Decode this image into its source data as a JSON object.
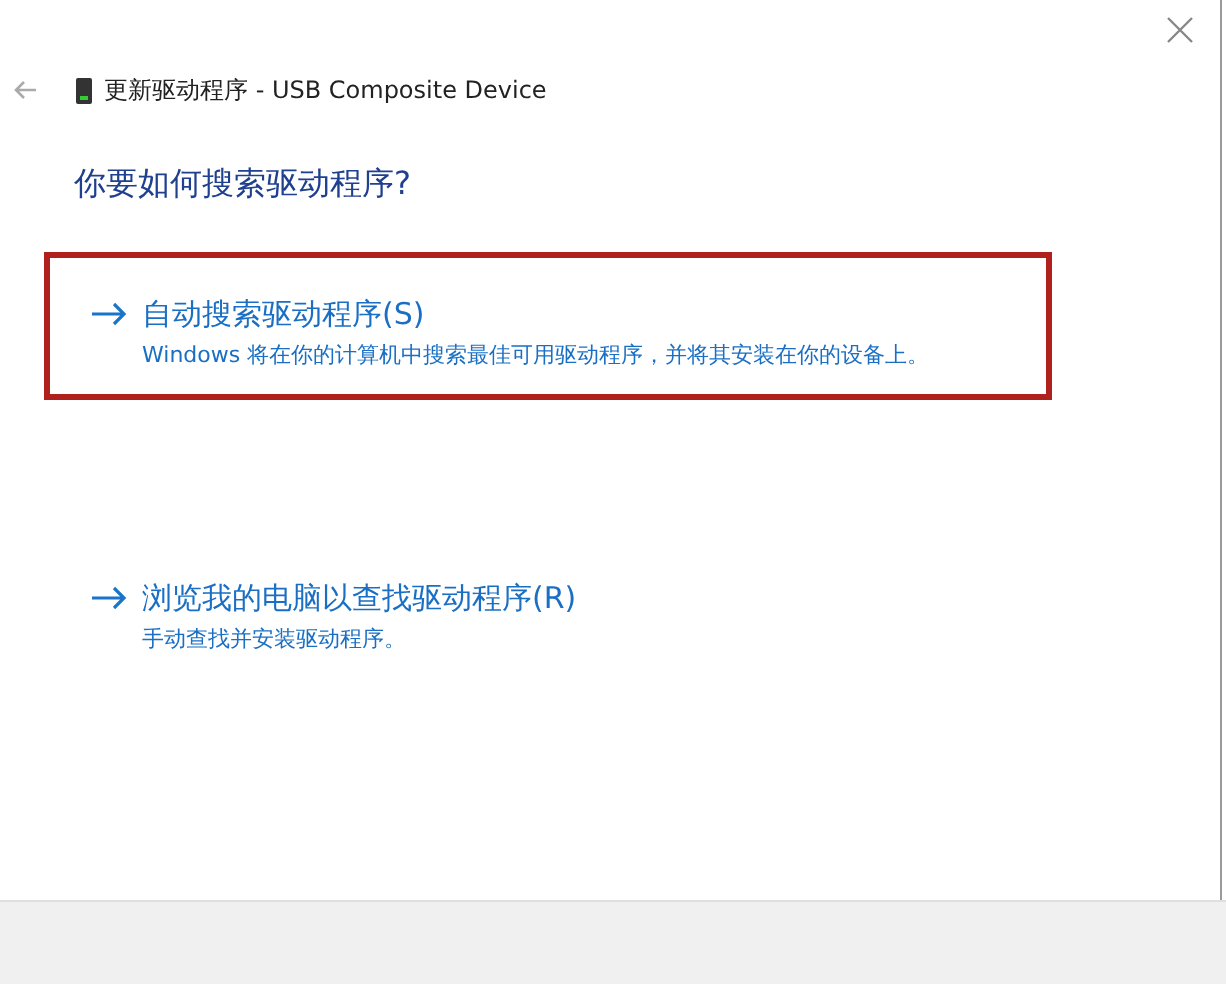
{
  "window": {
    "title": "更新驱动程序 - USB Composite Device"
  },
  "heading": "你要如何搜索驱动程序?",
  "options": [
    {
      "label": "自动搜索驱动程序(S)",
      "description": "Windows 将在你的计算机中搜索最佳可用驱动程序，并将其安装在你的设备上。",
      "highlighted": true
    },
    {
      "label": "浏览我的电脑以查找驱动程序(R)",
      "description": "手动查找并安装驱动程序。",
      "highlighted": false
    }
  ]
}
